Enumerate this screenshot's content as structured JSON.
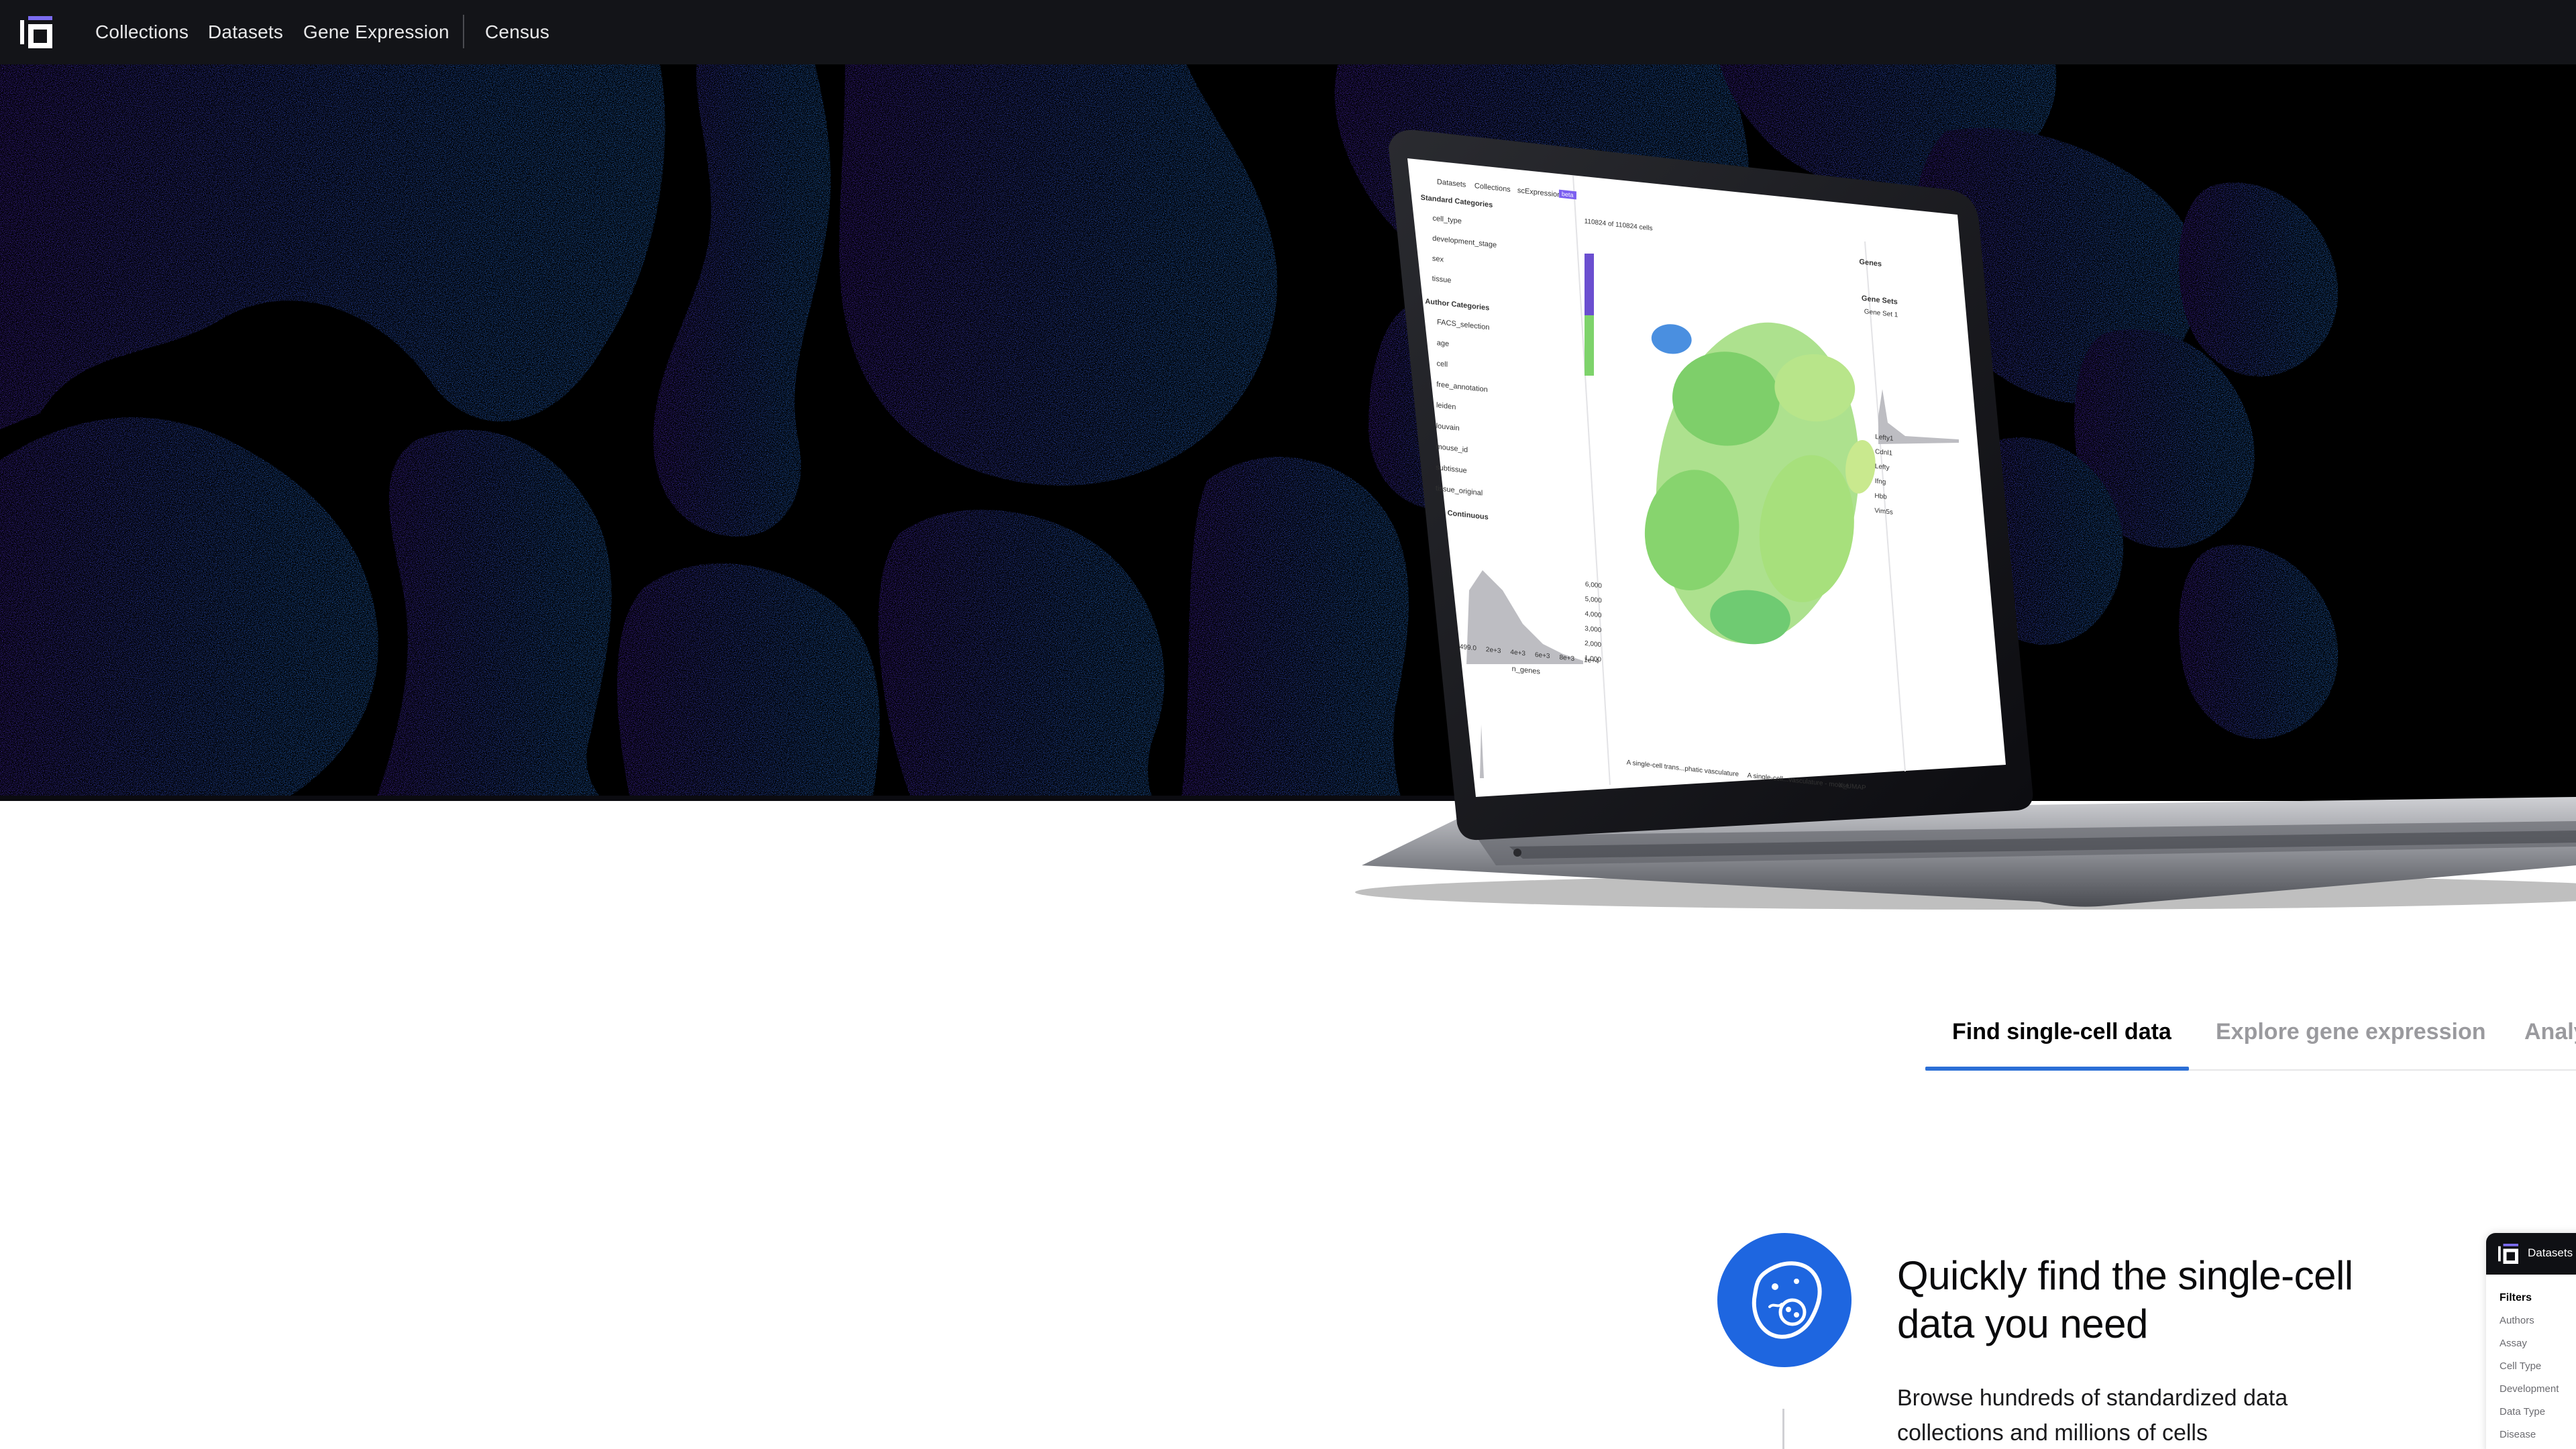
{
  "nav": {
    "logo_icon": "cellxgene-logo-icon",
    "links": [
      "Collections",
      "Datasets",
      "Gene Expression",
      "Census"
    ]
  },
  "laptop_screen": {
    "nav": {
      "datasets": "Datasets",
      "collections": "Collections",
      "app": "scExpression",
      "badge": "beta"
    },
    "cell_count": "110824 of 110824 cells",
    "standard_categories_title": "Standard Categories",
    "standard_categories": [
      "cell_type",
      "development_stage",
      "sex",
      "tissue"
    ],
    "author_categories_title": "Author Categories",
    "author_categories": [
      "FACS_selection",
      "age",
      "cell",
      "free_annotation",
      "leiden",
      "louvain",
      "mouse_id",
      "subtissue",
      "tissue_original"
    ],
    "continuous_title": "Continuous",
    "histogram_label": "n_genes",
    "histogram_ticks": [
      "499.0",
      "2e+3",
      "4e+3",
      "6e+3",
      "8e+3",
      "1e+4"
    ],
    "histogram_y_ticks": [
      "6,000",
      "5,000",
      "4,000",
      "3,000",
      "2,000",
      "1,000"
    ],
    "genes_title": "Genes",
    "gene_sets_title": "Gene Sets",
    "gene_set_label": "Gene Set 1",
    "genes": [
      "Lefty1",
      "Cdnl1",
      "Lefty",
      "Ifng",
      "Hbb",
      "Vim5s"
    ],
    "embedding_label": "A single-cell trans...phatic vasculature",
    "embedding_select": "A single-cell...vasculature - mouse",
    "umap_label": "X_UMAP"
  },
  "tabs": [
    {
      "label": "Find single-cell data",
      "active": true
    },
    {
      "label": "Explore gene expression",
      "active": false
    },
    {
      "label": "Analyze",
      "active": false
    }
  ],
  "feature": {
    "icon": "cell-icon",
    "title": "Quickly find the single-cell data you need",
    "description": "Browse hundreds of standardized data collections and millions of cells"
  },
  "preview": {
    "header": "Datasets",
    "filters_title": "Filters",
    "filters": [
      "Authors",
      "Assay",
      "Cell Type",
      "Development",
      "Data Type",
      "Disease"
    ]
  },
  "colors": {
    "nav_bg": "#131418",
    "accent_blue": "#2b6fd6",
    "icon_circle": "#1e66e0",
    "hero_purple": "#5a3fd6",
    "hero_blue": "#2f7af0"
  }
}
